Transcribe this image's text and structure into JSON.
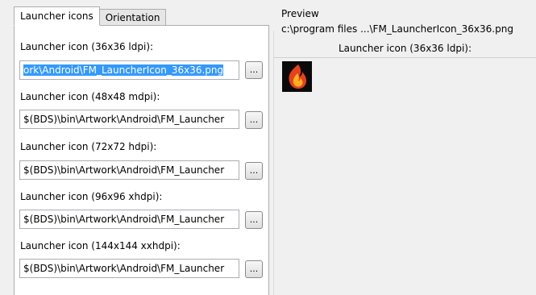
{
  "tabs": [
    {
      "label": "Launcher icons",
      "active": true
    },
    {
      "label": "Orientation",
      "active": false
    }
  ],
  "fields": [
    {
      "label": "Launcher icon (36x36 ldpi):",
      "value": "ork\\Android\\FM_LauncherIcon_36x36.png",
      "button": "..."
    },
    {
      "label": "Launcher icon (48x48 mdpi):",
      "value": "$(BDS)\\bin\\Artwork\\Android\\FM_Launcher",
      "button": "..."
    },
    {
      "label": "Launcher icon (72x72 hdpi):",
      "value": "$(BDS)\\bin\\Artwork\\Android\\FM_Launcher",
      "button": "..."
    },
    {
      "label": "Launcher icon (96x96 xhdpi):",
      "value": "$(BDS)\\bin\\Artwork\\Android\\FM_Launcher",
      "button": "..."
    },
    {
      "label": "Launcher icon (144x144 xxhdpi):",
      "value": "$(BDS)\\bin\\Artwork\\Android\\FM_Launcher",
      "button": "..."
    }
  ],
  "preview": {
    "title": "Preview",
    "path": "c:\\program files ...\\FM_LauncherIcon_36x36.png",
    "caption": "Launcher icon (36x36 ldpi):",
    "icon": "flame-icon"
  },
  "colors": {
    "selection": "#3399ff",
    "flame_outer": "#e8401a",
    "flame_inner": "#ffb020"
  }
}
